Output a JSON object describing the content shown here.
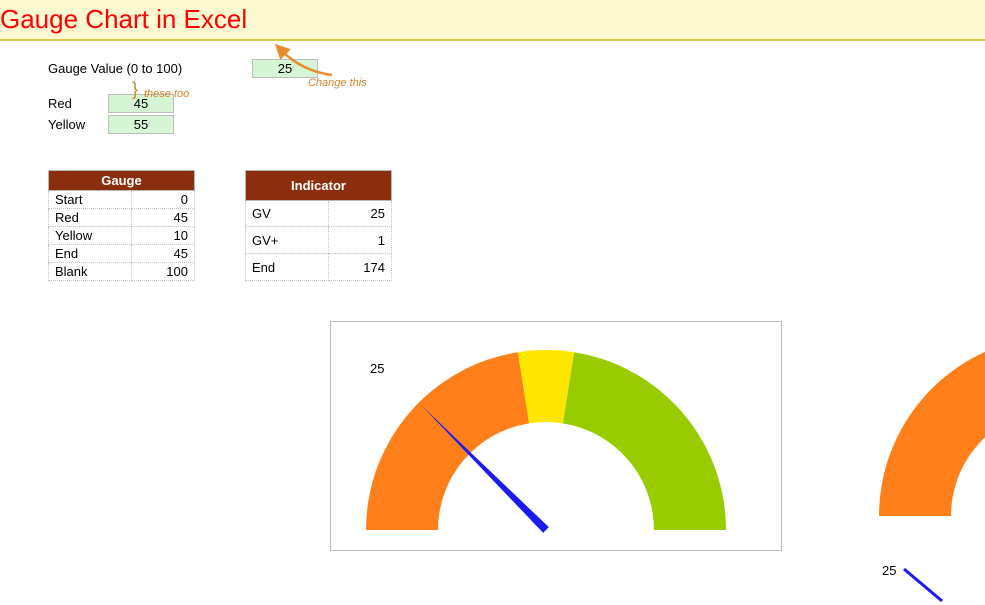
{
  "header": {
    "title": "Gauge Chart in Excel"
  },
  "inputs": {
    "gauge_value_label": "Gauge Value (0 to 100)",
    "gauge_value": "25",
    "red_label": "Red",
    "red_value": "45",
    "yellow_label": "Yellow",
    "yellow_value": "55",
    "annot_change": "Change this",
    "annot_these": "these too"
  },
  "gauge_table": {
    "title": "Gauge",
    "rows": [
      {
        "k": "Start",
        "v": "0"
      },
      {
        "k": "Red",
        "v": "45"
      },
      {
        "k": "Yellow",
        "v": "10"
      },
      {
        "k": "End",
        "v": "45"
      },
      {
        "k": "Blank",
        "v": "100"
      }
    ]
  },
  "indicator_table": {
    "title": "Indicator",
    "rows": [
      {
        "k": "GV",
        "v": "25"
      },
      {
        "k": "GV+",
        "v": "1"
      },
      {
        "k": "End",
        "v": "174"
      }
    ]
  },
  "gauge_needle_label": "25",
  "right_needle_label": "25",
  "chart_data": {
    "type": "pie",
    "title": "Gauge Chart in Excel",
    "gauge_value": 25,
    "segments": [
      {
        "name": "Red",
        "start": 0,
        "span": 45,
        "color": "#ff7f1a"
      },
      {
        "name": "Yellow",
        "start": 45,
        "span": 10,
        "color": "#ffe600"
      },
      {
        "name": "Green",
        "start": 55,
        "span": 45,
        "color": "#99cc00"
      },
      {
        "name": "Blank",
        "start": 100,
        "span": 100,
        "color": "transparent"
      }
    ],
    "indicator": {
      "GV": 25,
      "GV_plus": 1,
      "End": 174
    },
    "range": [
      0,
      100
    ]
  }
}
